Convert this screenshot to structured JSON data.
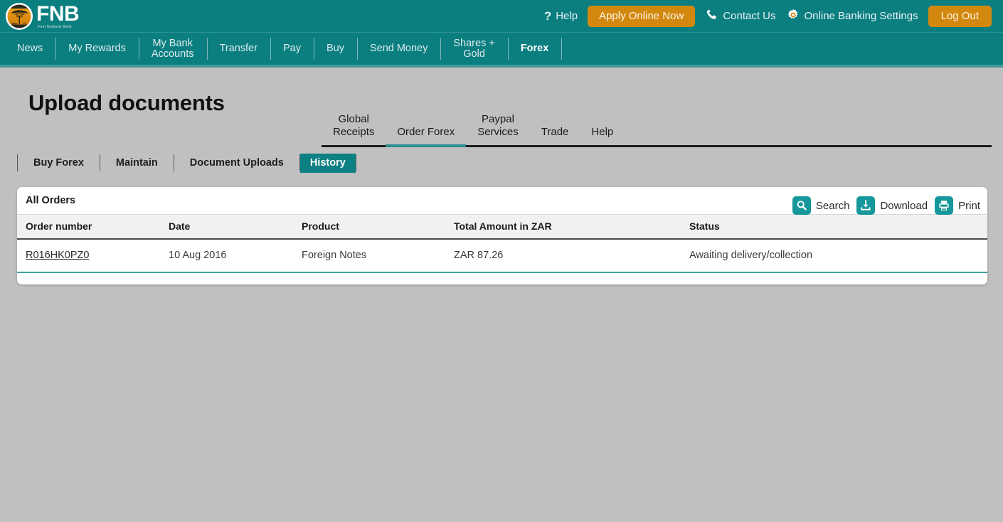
{
  "brand": {
    "name": "FNB",
    "tagline": "First National Bank",
    "teal": "#0b7e80",
    "orange": "#d2880f",
    "accent": "#15979b",
    "page_bg": "#c0c0c0"
  },
  "header": {
    "help": {
      "label": "Help",
      "icon": "question-mark-icon"
    },
    "apply": {
      "label": "Apply Online Now"
    },
    "contact": {
      "label": "Contact Us",
      "icon": "phone-icon"
    },
    "settings": {
      "label": "Online Banking Settings",
      "icon": "gear-icon"
    },
    "logout": {
      "label": "Log Out"
    }
  },
  "main_nav": {
    "items": [
      {
        "label": "News",
        "active": false
      },
      {
        "label": "My Rewards",
        "active": false
      },
      {
        "label": "My Bank\nAccounts",
        "active": false
      },
      {
        "label": "Transfer",
        "active": false
      },
      {
        "label": "Pay",
        "active": false
      },
      {
        "label": "Buy",
        "active": false
      },
      {
        "label": "Send Money",
        "active": false
      },
      {
        "label": "Shares +\nGold",
        "active": false
      },
      {
        "label": "Forex",
        "active": true
      }
    ]
  },
  "page": {
    "title": "Upload documents"
  },
  "top_tabs": {
    "items": [
      {
        "label": "Global\nReceipts",
        "active": false
      },
      {
        "label": "Order Forex",
        "active": true
      },
      {
        "label": "Paypal\nServices",
        "active": false
      },
      {
        "label": "Trade",
        "active": false
      },
      {
        "label": "Help",
        "active": false
      }
    ]
  },
  "sub_tabs": {
    "items": [
      {
        "label": "Buy Forex",
        "active": false
      },
      {
        "label": "Maintain",
        "active": false
      },
      {
        "label": "Document Uploads",
        "active": false
      },
      {
        "label": "History",
        "active": true
      }
    ]
  },
  "card": {
    "title": "All Orders",
    "actions": [
      {
        "label": "Search",
        "icon": "search-icon"
      },
      {
        "label": "Download",
        "icon": "download-icon"
      },
      {
        "label": "Print",
        "icon": "print-icon"
      }
    ],
    "columns": [
      "Order number",
      "Date",
      "Product",
      "Total Amount in ZAR",
      "Status"
    ],
    "rows": [
      {
        "order_number": "R016HK0PZ0",
        "date": "10 Aug 2016",
        "product": "Foreign Notes",
        "amount": "ZAR 87.26",
        "status": "Awaiting delivery/collection"
      }
    ]
  }
}
